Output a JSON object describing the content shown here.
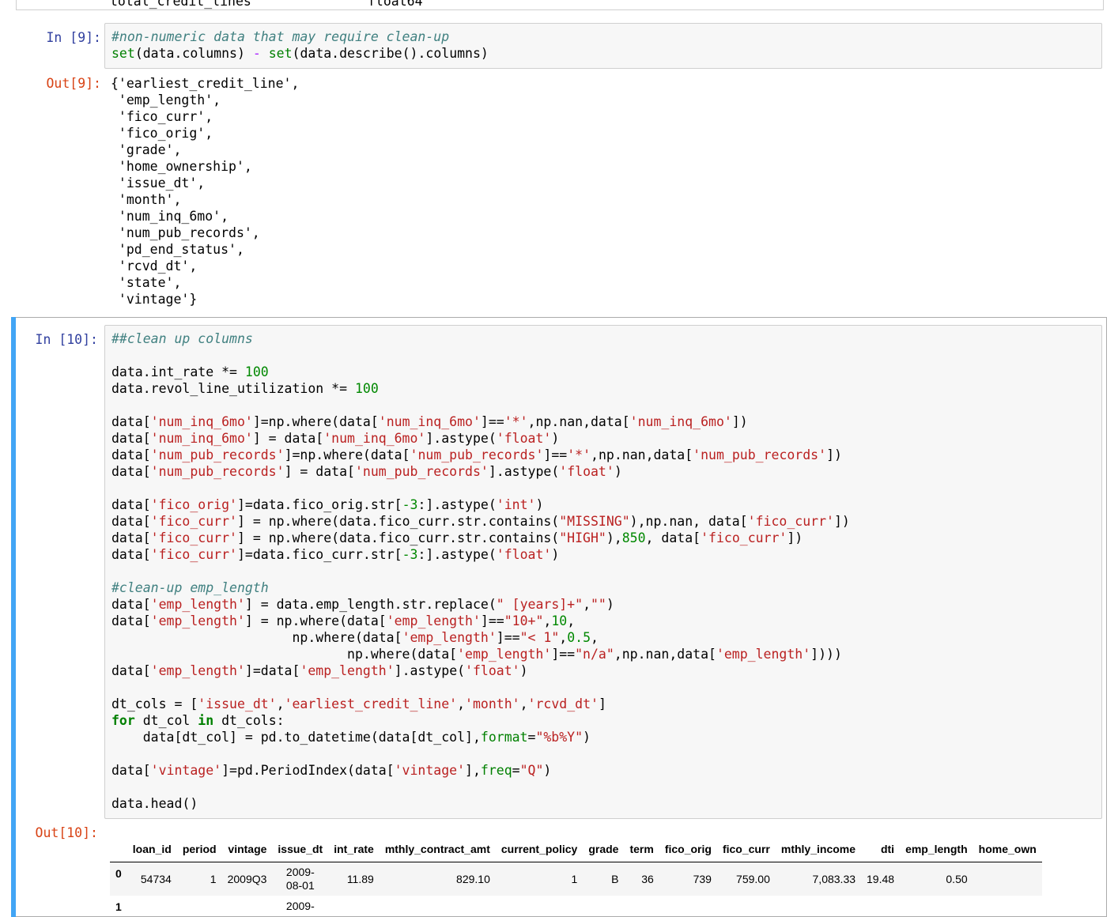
{
  "prev_output": {
    "col1": "total_credit_lines",
    "col2": "float64"
  },
  "cell9": {
    "in_prompt": "In [9]:",
    "code": {
      "line1_comment": "#non-numeric data that may require clean-up",
      "line2_set1": "set",
      "line2_mid1": "(data.columns) ",
      "line2_minus": "-",
      "line2_space": " ",
      "line2_set2": "set",
      "line2_rest": "(data.describe().columns)"
    },
    "out_prompt": "Out[9]:",
    "output_lines": [
      "{'earliest_credit_line',",
      " 'emp_length',",
      " 'fico_curr',",
      " 'fico_orig',",
      " 'grade',",
      " 'home_ownership',",
      " 'issue_dt',",
      " 'month',",
      " 'num_inq_6mo',",
      " 'num_pub_records',",
      " 'pd_end_status',",
      " 'rcvd_dt',",
      " 'state',",
      " 'vintage'}"
    ]
  },
  "cell10": {
    "in_prompt": "In [10]:",
    "out_prompt": "Out[10]:",
    "code": {
      "c1": "##clean up columns",
      "l_int_a": "data.int_rate *= ",
      "l_int_n": "100",
      "l_revol_a": "data.revol_line_utilization *= ",
      "l_revol_n": "100",
      "inq1": [
        "data[",
        "'num_inq_6mo'",
        "]=np.where(data[",
        "'num_inq_6mo'",
        "]==",
        "'*'",
        ",np.nan,data[",
        "'num_inq_6mo'",
        "])"
      ],
      "inq2": [
        "data[",
        "'num_inq_6mo'",
        "] = data[",
        "'num_inq_6mo'",
        "].astype(",
        "'float'",
        ")"
      ],
      "pub1": [
        "data[",
        "'num_pub_records'",
        "]=np.where(data[",
        "'num_pub_records'",
        "]==",
        "'*'",
        ",np.nan,data[",
        "'num_pub_records'",
        "])"
      ],
      "pub2": [
        "data[",
        "'num_pub_records'",
        "] = data[",
        "'num_pub_records'",
        "].astype(",
        "'float'",
        ")"
      ],
      "fo1": [
        "data[",
        "'fico_orig'",
        "]=data.fico_orig.str[",
        "-3",
        ":].astype(",
        "'int'",
        ")"
      ],
      "fc1": [
        "data[",
        "'fico_curr'",
        "] = np.where(data.fico_curr.str.contains(",
        "\"MISSING\"",
        "),np.nan, data[",
        "'fico_curr'",
        "])"
      ],
      "fc2": [
        "data[",
        "'fico_curr'",
        "] = np.where(data.fico_curr.str.contains(",
        "\"HIGH\"",
        "),",
        "850",
        ", data[",
        "'fico_curr'",
        "])"
      ],
      "fc3": [
        "data[",
        "'fico_curr'",
        "]=data.fico_curr.str[",
        "-3",
        ":].astype(",
        "'float'",
        ")"
      ],
      "c2": "#clean-up emp_length",
      "el1": [
        "data[",
        "'emp_length'",
        "] = data.emp_length.str.replace(",
        "\" [years]+\"",
        ",",
        "\"\"",
        ")"
      ],
      "el2": [
        "data[",
        "'emp_length'",
        "] = np.where(data[",
        "'emp_length'",
        "]==",
        "\"10+\"",
        ",",
        "10",
        ","
      ],
      "el3": [
        "                       np.where(data[",
        "'emp_length'",
        "]==",
        "\"< 1\"",
        ",",
        "0.5",
        ","
      ],
      "el4": [
        "                              np.where(data[",
        "'emp_length'",
        "]==",
        "\"n/a\"",
        ",np.nan,data[",
        "'emp_length'",
        "])))"
      ],
      "el5": [
        "data[",
        "'emp_length'",
        "]=data[",
        "'emp_length'",
        "].astype(",
        "'float'",
        ")"
      ],
      "dt1": [
        "dt_cols = [",
        "'issue_dt'",
        ",",
        "'earliest_credit_line'",
        ",",
        "'month'",
        ",",
        "'rcvd_dt'",
        "]"
      ],
      "dt2": [
        "for",
        " dt_col ",
        "in",
        " dt_cols:"
      ],
      "dt3": [
        "    data[dt_col] = pd.to_datetime(data[dt_col],",
        "format",
        "=",
        "\"%b%Y\"",
        ")"
      ],
      "vin": [
        "data[",
        "'vintage'",
        "]=pd.PeriodIndex(data[",
        "'vintage'",
        "],",
        "freq",
        "=",
        "\"Q\"",
        ")"
      ],
      "head": "data.head()"
    }
  },
  "dataframe": {
    "columns": [
      "",
      "loan_id",
      "period",
      "vintage",
      "issue_dt",
      "int_rate",
      "mthly_contract_amt",
      "current_policy",
      "grade",
      "term",
      "fico_orig",
      "fico_curr",
      "mthly_income",
      "dti",
      "emp_length",
      "home_own"
    ],
    "rows": [
      {
        "idx": "0",
        "loan_id": "54734",
        "period": "1",
        "vintage": "2009Q3",
        "issue_dt_a": "2009-",
        "issue_dt_b": "08-01",
        "int_rate": "11.89",
        "mthly_contract_amt": "829.10",
        "current_policy": "1",
        "grade": "B",
        "term": "36",
        "fico_orig": "739",
        "fico_curr": "759.00",
        "mthly_income": "7,083.33",
        "dti": "19.48",
        "emp_length": "0.50"
      },
      {
        "idx": "1",
        "issue_dt_a": "2009-"
      }
    ]
  }
}
